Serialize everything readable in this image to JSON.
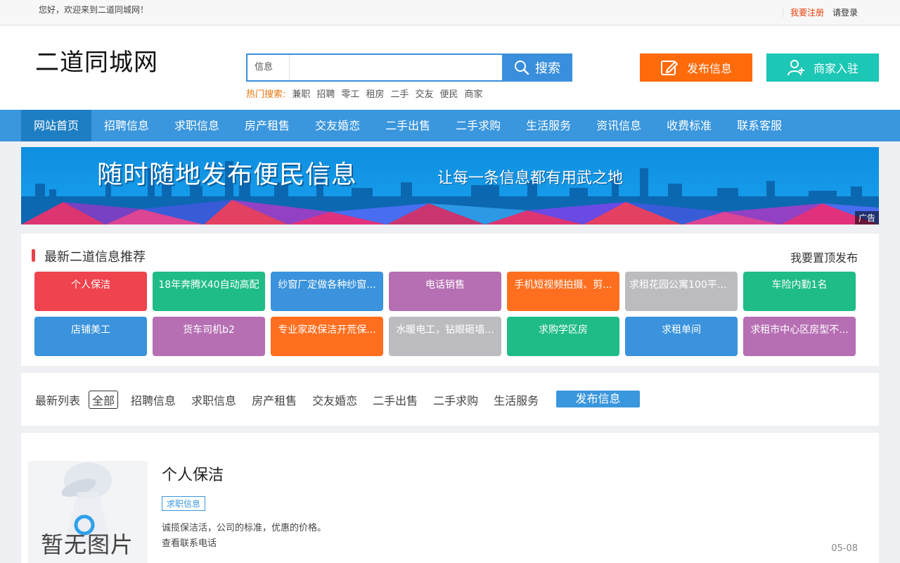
{
  "topbar": {
    "welcome": "您好，欢迎来到二道同城网！",
    "register": "我要注册",
    "login": "请登录"
  },
  "header": {
    "logo": "二道同城网",
    "search": {
      "category": "信息",
      "placeholder": "",
      "button": "搜索"
    },
    "hot_label": "热门搜索:",
    "hot_words": [
      "兼职",
      "招聘",
      "零工",
      "租房",
      "二手",
      "交友",
      "便民",
      "商家"
    ],
    "publish_button": "发布信息",
    "merchant_button": "商家入驻"
  },
  "nav": [
    "网站首页",
    "招聘信息",
    "求职信息",
    "房产租售",
    "交友婚恋",
    "二手出售",
    "二手求购",
    "生活服务",
    "资讯信息",
    "收费标准",
    "联系客服"
  ],
  "banner": {
    "title": "随时随地发布便民信息",
    "slogan": "让每一条信息都有用武之地",
    "ad": "广告"
  },
  "recommend": {
    "title": "最新二道信息推荐",
    "top_publish": "我要置顶发布",
    "tiles": [
      {
        "label": "个人保洁",
        "color": "#ef434e"
      },
      {
        "label": "18年奔腾X40自动高配",
        "color": "#1fbc88"
      },
      {
        "label": "纱窗厂定做各种纱窗...",
        "color": "#3a93dc"
      },
      {
        "label": "电话销售",
        "color": "#b66fb3"
      },
      {
        "label": "手机短视频拍摄、剪...",
        "color": "#ff6f1f"
      },
      {
        "label": "求租花园公寓100平方...",
        "color": "#bcbcc0"
      },
      {
        "label": "车险内勤1名",
        "color": "#1fbc88"
      },
      {
        "label": "店铺美工",
        "color": "#3a93dc"
      },
      {
        "label": "货车司机b2",
        "color": "#b66fb3"
      },
      {
        "label": "专业家政保洁开荒保...",
        "color": "#ff6f1f"
      },
      {
        "label": "水暖电工，钻眼砸墙...",
        "color": "#bcbcc0"
      },
      {
        "label": "求购学区房",
        "color": "#1fbc88"
      },
      {
        "label": "求租单间",
        "color": "#3a93dc"
      },
      {
        "label": "求租市中心区房型不...",
        "color": "#b66fb3"
      }
    ]
  },
  "filter": {
    "label": "最新列表",
    "all": "全部",
    "items": [
      "招聘信息",
      "求职信息",
      "房产租售",
      "交友婚恋",
      "二手出售",
      "二手求购",
      "生活服务"
    ],
    "publish": "发布信息"
  },
  "listing": {
    "no_image": "暂无图片",
    "title": "个人保洁",
    "tag": "求职信息",
    "desc": "诚揽保洁活，公司的标准，优惠的价格。",
    "phone": "查看联系电话",
    "date": "05-08"
  }
}
